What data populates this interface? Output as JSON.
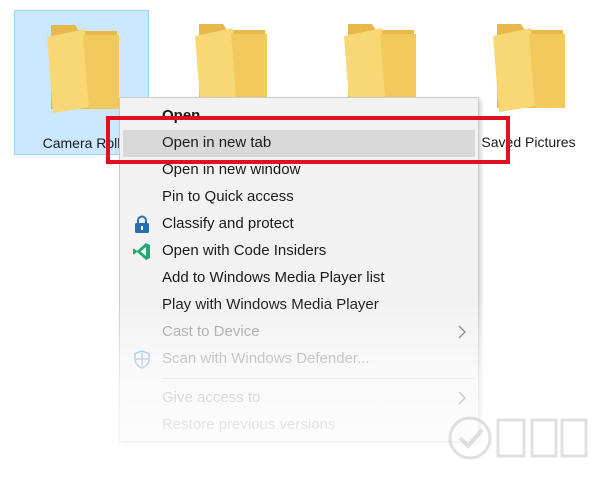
{
  "folders": [
    {
      "label": "Camera Roll",
      "selected": true
    },
    {
      "label": "",
      "selected": false
    },
    {
      "label": "",
      "selected": false
    },
    {
      "label": "Saved Pictures",
      "selected": false
    }
  ],
  "menu": {
    "items": [
      {
        "label": "Open",
        "bold": true,
        "icon": null
      },
      {
        "label": "Open in new tab",
        "hover": true,
        "icon": null
      },
      {
        "label": "Open in new window",
        "icon": null
      },
      {
        "label": "Pin to Quick access",
        "icon": null
      },
      {
        "label": "Classify and protect",
        "icon": "lock-icon"
      },
      {
        "label": "Open with Code Insiders",
        "icon": "code-insiders-icon"
      },
      {
        "label": "Add to Windows Media Player list",
        "icon": null
      },
      {
        "label": "Play with Windows Media Player",
        "icon": null
      },
      {
        "label": "Cast to Device",
        "disabled": true,
        "submenu": true,
        "icon": null
      },
      {
        "label": "Scan with Windows Defender...",
        "disabled": true,
        "icon": "defender-shield-icon"
      },
      {
        "label": "Give access to",
        "disabled": true,
        "submenu": true,
        "icon": null
      },
      {
        "label": "Restore previous versions",
        "disabled": true,
        "icon": null
      }
    ]
  },
  "colors": {
    "folder": "#f8d775",
    "folder_dark": "#e8b94a",
    "selection": "#cce8ff",
    "menu_bg": "#f2f2f2",
    "hover": "#d9d9d9",
    "highlight": "#e0101e"
  }
}
